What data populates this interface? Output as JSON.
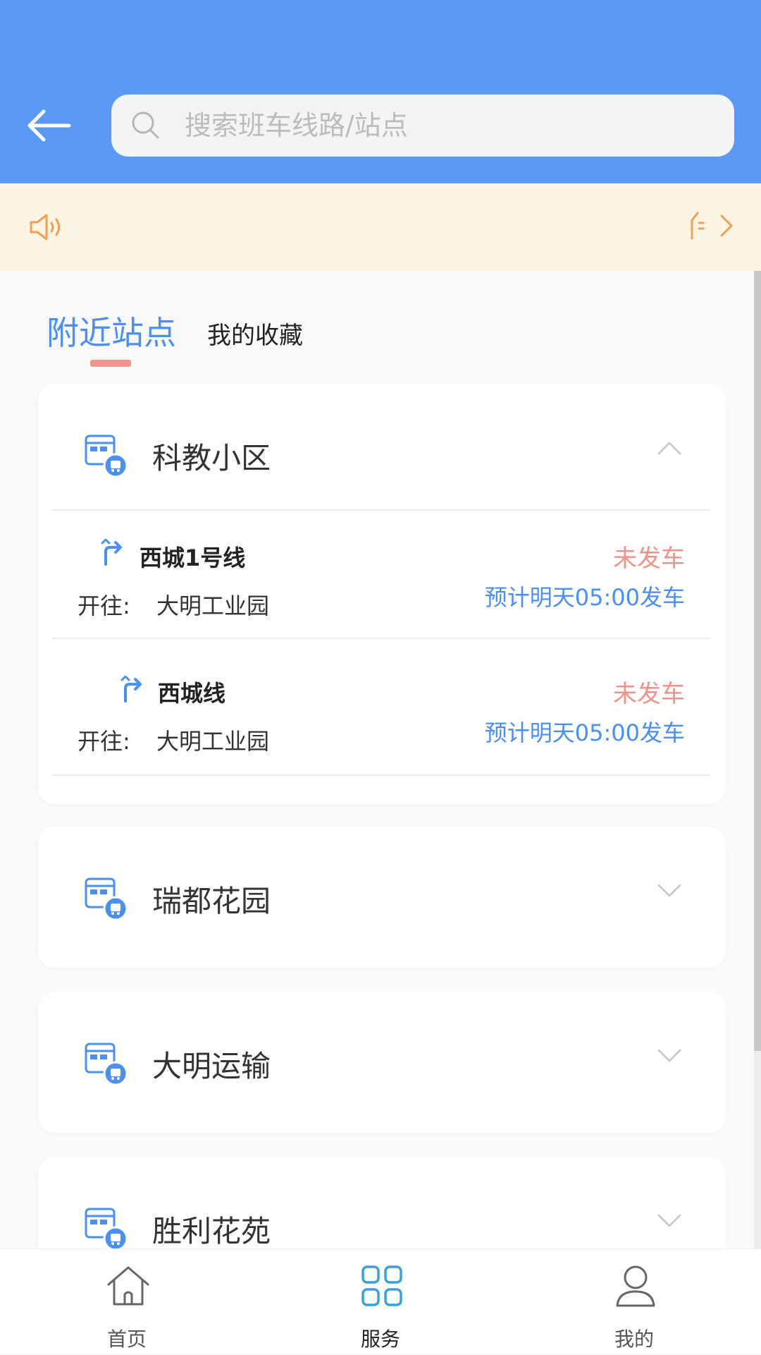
{
  "header": {
    "search_placeholder": "搜索班车线路/站点"
  },
  "tabs": [
    {
      "label": "附近站点",
      "active": true
    },
    {
      "label": "我的收藏",
      "active": false
    }
  ],
  "stops": [
    {
      "name": "科教小区",
      "expanded": true,
      "routes": [
        {
          "name": "西城1号线",
          "direction_label": "开往:",
          "destination": "大明工业园",
          "status": "未发车",
          "eta": "预计明天05:00发车"
        },
        {
          "name": "西城线",
          "direction_label": "开往:",
          "destination": "大明工业园",
          "status": "未发车",
          "eta": "预计明天05:00发车"
        }
      ]
    },
    {
      "name": "瑞都花园",
      "expanded": false
    },
    {
      "name": "大明运输",
      "expanded": false
    },
    {
      "name": "胜利花苑",
      "expanded": false
    }
  ],
  "bottom_nav": [
    {
      "label": "首页",
      "icon": "home-icon",
      "active": false
    },
    {
      "label": "服务",
      "icon": "grid-icon",
      "active": true
    },
    {
      "label": "我的",
      "icon": "user-icon",
      "active": false
    }
  ],
  "colors": {
    "header_bg": "#5a9af6",
    "notice_bg": "#fdf5e4",
    "accent_blue": "#4a8ff2",
    "accent_orange": "#f0a050",
    "status_red": "#f2938a",
    "nav_active": "#3aa0d8"
  }
}
